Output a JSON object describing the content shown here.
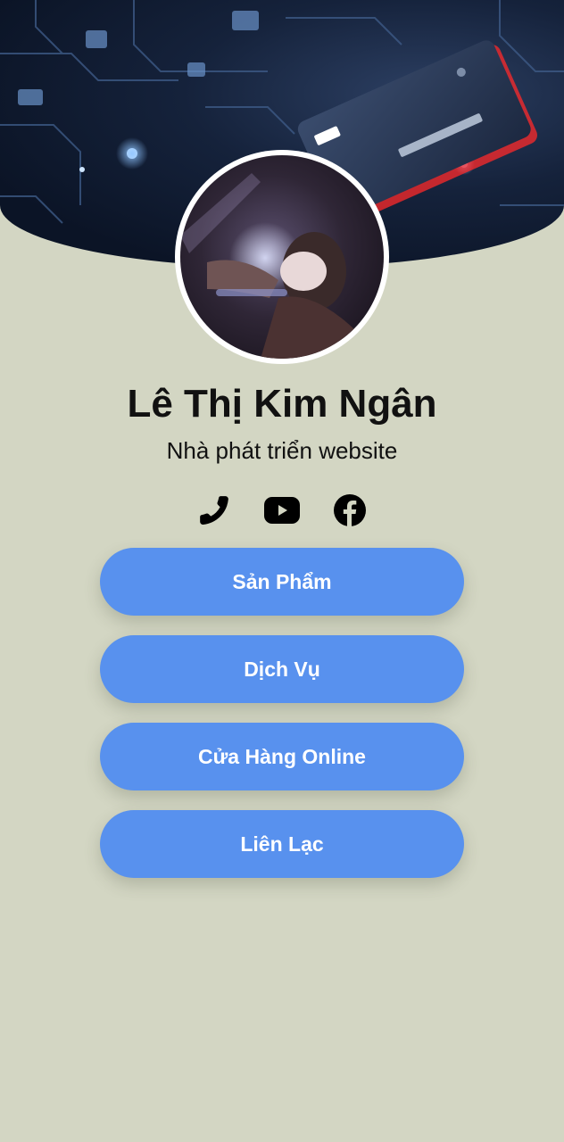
{
  "profile": {
    "name": "Lê Thị Kim Ngân",
    "role": "Nhà phát triển website"
  },
  "socials": [
    {
      "icon": "phone-icon"
    },
    {
      "icon": "youtube-icon"
    },
    {
      "icon": "facebook-icon"
    }
  ],
  "links": [
    {
      "label": "Sản Phẩm"
    },
    {
      "label": "Dịch Vụ"
    },
    {
      "label": "Cửa Hàng Online"
    },
    {
      "label": "Liên Lạc"
    }
  ],
  "colors": {
    "background": "#d3d6c3",
    "button": "#5891ee",
    "button_text": "#ffffff",
    "text": "#111111"
  }
}
